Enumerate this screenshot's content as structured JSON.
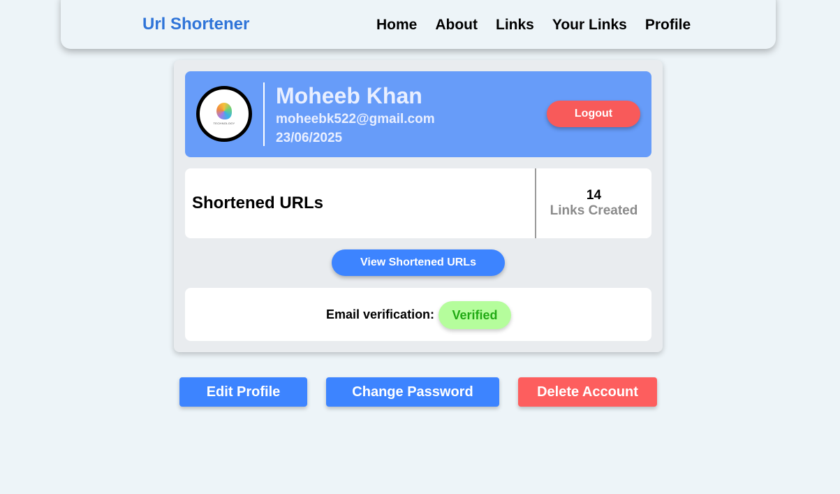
{
  "nav": {
    "brand": "Url Shortener",
    "links": [
      "Home",
      "About",
      "Links",
      "Your Links",
      "Profile"
    ]
  },
  "profile": {
    "name": "Moheeb Khan",
    "email": "moheebk522@gmail.com",
    "date": "23/06/2025",
    "avatar_caption": "TECHNOLOGY",
    "logout_label": "Logout"
  },
  "stats": {
    "title": "Shortened URLs",
    "count": "14",
    "count_label": "Links Created"
  },
  "view_button_label": "View Shortened URLs",
  "verification": {
    "label": "Email verification:",
    "status": "Verified"
  },
  "actions": {
    "edit": "Edit Profile",
    "change_password": "Change Password",
    "delete": "Delete Account"
  },
  "colors": {
    "brand": "#2f74d8",
    "header_bg": "#679cf9",
    "primary": "#3d84ff",
    "danger": "#fd5e5e",
    "success_bg": "#b5fd9c",
    "success_text": "#22aa14"
  },
  "icons": {
    "avatar": "technology-head-logo-icon"
  }
}
